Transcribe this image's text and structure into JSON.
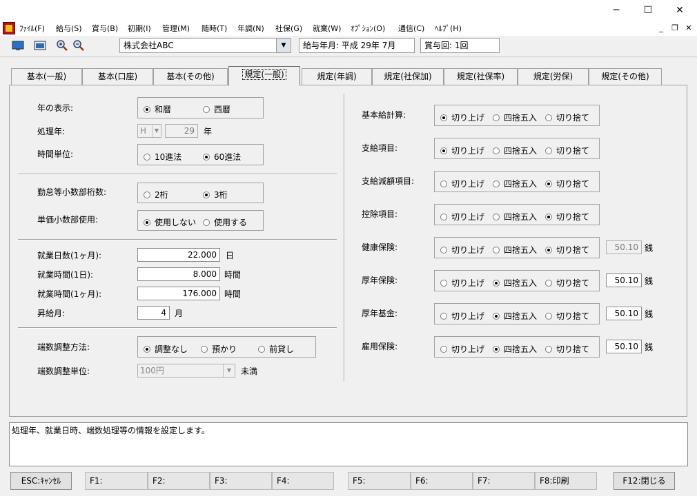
{
  "window": {
    "minimize": "─",
    "maximize": "☐",
    "close": "✕"
  },
  "menu": [
    "ﾌｧｲﾙ(F)",
    "給与(S)",
    "賞与(B)",
    "初期(I)",
    "管理(M)",
    "随時(T)",
    "年調(N)",
    "社保(G)",
    "就業(W)",
    "ｵﾌﾟｼｮﾝ(O)",
    "通信(C)",
    "ﾍﾙﾌﾟ(H)"
  ],
  "mdi": {
    "minimize": "_",
    "restore": "❐",
    "close": "✕"
  },
  "toolbar": {
    "company": "株式会社ABC",
    "pay_month": "給与年月: 平成 29年  7月",
    "bonus_count": "賞与回: 1回"
  },
  "tabs": [
    "基本(一般)",
    "基本(口座)",
    "基本(その他)",
    "規定(一般)",
    "規定(年調)",
    "規定(社保加)",
    "規定(社保率)",
    "規定(労保)",
    "規定(その他)"
  ],
  "active_tab": 3,
  "left": {
    "year_display_label": "年の表示:",
    "year_display_options": [
      "和暦",
      "西暦"
    ],
    "year_display_selected": 0,
    "proc_year_label": "処理年:",
    "proc_year_era": "H",
    "proc_year_value": "29",
    "proc_year_unit": "年",
    "time_unit_label": "時間単位:",
    "time_unit_options": [
      "10進法",
      "60進法"
    ],
    "time_unit_selected": 1,
    "attend_decimal_label": "勤怠等小数部桁数:",
    "attend_decimal_options": [
      "2桁",
      "3桁"
    ],
    "attend_decimal_selected": 1,
    "unit_price_decimal_label": "単価小数部使用:",
    "unit_price_decimal_options": [
      "使用しない",
      "使用する"
    ],
    "unit_price_decimal_selected": 0,
    "work_days_label": "就業日数(1ヶ月):",
    "work_days_value": "22.000",
    "work_days_unit": "日",
    "work_hours_day_label": "就業時間(1日):",
    "work_hours_day_value": "8.000",
    "work_hours_day_unit": "時間",
    "work_hours_month_label": "就業時間(1ヶ月):",
    "work_hours_month_value": "176.000",
    "work_hours_month_unit": "時間",
    "raise_month_label": "昇給月:",
    "raise_month_value": "4",
    "raise_month_unit": "月",
    "rounding_method_label": "端数調整方法:",
    "rounding_method_options": [
      "調整なし",
      "預かり",
      "前貸し"
    ],
    "rounding_method_selected": 0,
    "rounding_unit_label": "端数調整単位:",
    "rounding_unit_value": "100円",
    "rounding_unit_suffix": "未満"
  },
  "right": {
    "options": [
      "切り上げ",
      "四捨五入",
      "切り捨て"
    ],
    "rows": [
      {
        "label": "基本給計算:",
        "selected": 0
      },
      {
        "label": "支給項目:",
        "selected": 0
      },
      {
        "label": "支給減額項目:",
        "selected": 2
      },
      {
        "label": "控除項目:",
        "selected": 2
      },
      {
        "label": "健康保険:",
        "selected": 2,
        "rate": "50.10",
        "unit": "銭",
        "rate_disabled": true
      },
      {
        "label": "厚年保険:",
        "selected": 1,
        "rate": "50.10",
        "unit": "銭",
        "rate_disabled": false
      },
      {
        "label": "厚年基金:",
        "selected": 1,
        "rate": "50.10",
        "unit": "銭",
        "rate_disabled": false
      },
      {
        "label": "雇用保険:",
        "selected": 1,
        "rate": "50.10",
        "unit": "銭",
        "rate_disabled": false
      }
    ]
  },
  "status": "処理年、就業日時、端数処理等の情報を設定します。",
  "fkeys": [
    "ESC:ｷｬﾝｾﾙ",
    "F1:",
    "F2:",
    "F3:",
    "F4:",
    "F5:",
    "F6:",
    "F7:",
    "F8:印刷",
    "F12:閉じる"
  ]
}
